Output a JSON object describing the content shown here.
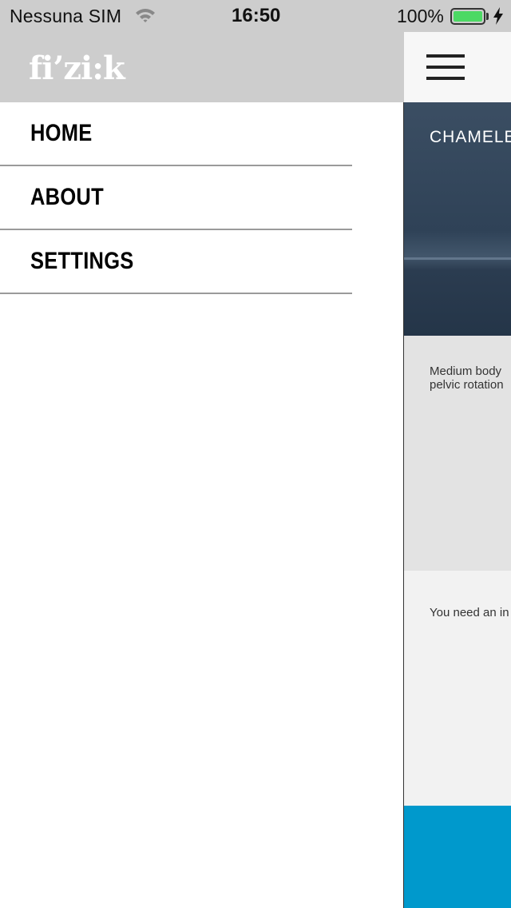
{
  "status_bar": {
    "carrier": "Nessuna SIM",
    "time": "16:50",
    "battery_percent": "100%",
    "battery_level": 1.0,
    "battery_color": "#4cd964",
    "icons": [
      "wifi-icon",
      "battery-icon",
      "charging-bolt-icon"
    ]
  },
  "drawer": {
    "logo": "fi’zi:k",
    "menu": [
      {
        "label": "HOME"
      },
      {
        "label": "ABOUT"
      },
      {
        "label": "SETTINGS"
      }
    ]
  },
  "content": {
    "menu_icon": "hamburger-menu-icon",
    "banner_title": "CHAMELE",
    "description": "Medium body\npelvic rotation",
    "notice": "You need an in",
    "accent_color": "#0099cc"
  }
}
